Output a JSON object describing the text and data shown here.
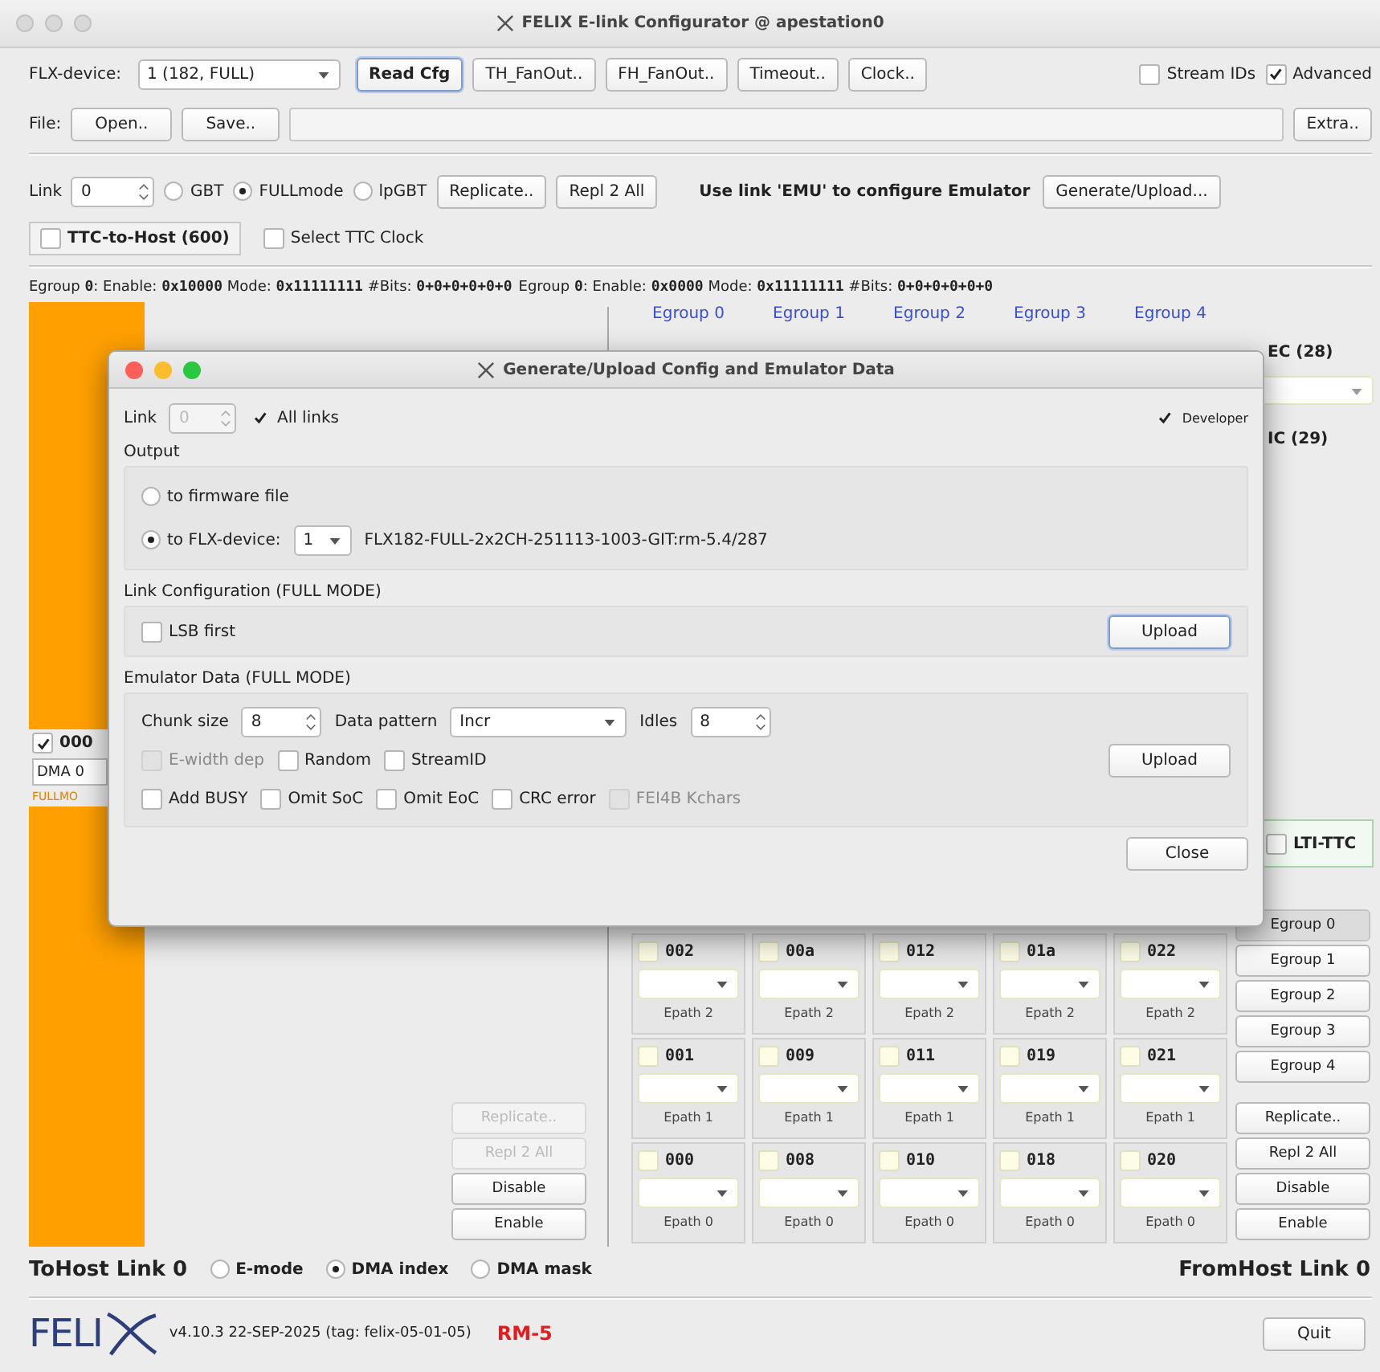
{
  "window": {
    "title": "FELIX E-link Configurator @ apestation0"
  },
  "toolbar": {
    "device_label": "FLX-device:",
    "device": "1 (182, FULL)",
    "buttons": [
      {
        "label": "Read Cfg",
        "kind": "default"
      },
      {
        "label": "TH_FanOut..",
        "kind": "plain"
      },
      {
        "label": "FH_FanOut..",
        "kind": "plain"
      },
      {
        "label": "Timeout..",
        "kind": "plain"
      },
      {
        "label": "Clock..",
        "kind": "plain"
      }
    ],
    "checkboxes": [
      {
        "label": "Stream IDs",
        "checked": false
      },
      {
        "label": "Advanced",
        "checked": true
      }
    ]
  },
  "file_row": {
    "label": "File:",
    "buttons": [
      "Open..",
      "Save.."
    ],
    "extra": "Extra.."
  },
  "link_row": {
    "label": "Link",
    "link": "0",
    "modes": [
      {
        "label": "GBT",
        "selected": false
      },
      {
        "label": "FULLmode",
        "selected": true
      },
      {
        "label": "lpGBT",
        "selected": false
      }
    ],
    "buttons": [
      "Replicate..",
      "Repl 2 All"
    ],
    "hint": "Use link 'EMU' to configure Emulator",
    "generate": "Generate/Upload..."
  },
  "ttc_row": [
    {
      "label": "TTC-to-Host (600)",
      "checked": false,
      "kind": "framed"
    },
    {
      "label": "Select TTC Clock",
      "checked": false,
      "kind": "plain"
    }
  ],
  "egroup_info": [
    "Egroup **0**: Enable: **0x10000** Mode: **0x11111111** #Bits: **0+0+0+0+0+0**",
    "Egroup **0**: Enable: **0x0000** Mode: **0x11111111** #Bits: **0+0+0+0+0+0**"
  ],
  "tohost": {
    "egroup": {
      "label": "000",
      "checked": true,
      "dma": "DMA 0",
      "mode": "FULLMO"
    },
    "buttons": [
      {
        "label": "Replicate..",
        "disabled": true
      },
      {
        "label": "Repl 2 All",
        "disabled": true
      },
      {
        "label": "Disable",
        "disabled": false
      },
      {
        "label": "Enable",
        "disabled": false
      }
    ]
  },
  "fromhost": {
    "egroup_headers": [
      "Egroup 0",
      "Egroup 1",
      "Egroup 2",
      "Egroup 3",
      "Egroup 4"
    ],
    "side": [
      {
        "kind": "label",
        "text": "EC (28)"
      },
      {
        "kind": "dropdown"
      },
      {
        "kind": "label",
        "text": "IC (29)"
      }
    ],
    "lti_ttc": {
      "label": "LTI-TTC",
      "checked": false
    },
    "rows": [
      {
        "cells": [
          {
            "id": "002",
            "checked": false,
            "epath": "Epath 2"
          },
          {
            "id": "00a",
            "checked": false,
            "epath": "Epath 2"
          },
          {
            "id": "012",
            "checked": false,
            "epath": "Epath 2"
          },
          {
            "id": "01a",
            "checked": false,
            "epath": "Epath 2"
          },
          {
            "id": "022",
            "checked": false,
            "epath": "Epath 2"
          }
        ]
      },
      {
        "cells": [
          {
            "id": "001",
            "checked": false,
            "epath": "Epath 1"
          },
          {
            "id": "009",
            "checked": false,
            "epath": "Epath 1"
          },
          {
            "id": "011",
            "checked": false,
            "epath": "Epath 1"
          },
          {
            "id": "019",
            "checked": false,
            "epath": "Epath 1"
          },
          {
            "id": "021",
            "checked": false,
            "epath": "Epath 1"
          }
        ]
      },
      {
        "cells": [
          {
            "id": "000",
            "checked": false,
            "epath": "Epath 0"
          },
          {
            "id": "008",
            "checked": false,
            "epath": "Epath 0"
          },
          {
            "id": "010",
            "checked": false,
            "epath": "Epath 0"
          },
          {
            "id": "018",
            "checked": false,
            "epath": "Epath 0"
          },
          {
            "id": "020",
            "checked": false,
            "epath": "Epath 0"
          }
        ]
      }
    ],
    "egroup_buttons": [
      {
        "label": "Egroup 0",
        "selected": true
      },
      {
        "label": "Egroup 1",
        "selected": false
      },
      {
        "label": "Egroup 2",
        "selected": false
      },
      {
        "label": "Egroup 3",
        "selected": false
      },
      {
        "label": "Egroup 4",
        "selected": false
      }
    ],
    "buttons": [
      {
        "label": "Replicate..",
        "disabled": false
      },
      {
        "label": "Repl 2 All",
        "disabled": false
      },
      {
        "label": "Disable",
        "disabled": false
      },
      {
        "label": "Enable",
        "disabled": false
      }
    ]
  },
  "footer": {
    "tohost_title": "ToHost Link 0",
    "modes": [
      {
        "label": "E-mode",
        "selected": false
      },
      {
        "label": "DMA index",
        "selected": true
      },
      {
        "label": "DMA mask",
        "selected": false
      }
    ],
    "fromhost_title": "FromHost Link 0",
    "logo": "FELI",
    "version": "v4.10.3  22-SEP-2025 (tag: felix-05-01-05)",
    "release": "RM-5",
    "quit": "Quit"
  },
  "dialog": {
    "title": "Generate/Upload Config and Emulator Data",
    "link_label": "Link",
    "link": "0",
    "link_disabled": true,
    "all_links": {
      "label": "All links",
      "checked": true
    },
    "developer": {
      "label": "Developer",
      "checked": true
    },
    "output_title": "Output",
    "targets": [
      {
        "label": "to firmware file",
        "selected": false
      },
      {
        "label": "to FLX-device:",
        "selected": true,
        "device": "1",
        "firmware": "FLX182-FULL-2x2CH-251113-1003-GIT:rm-5.4/287"
      }
    ],
    "link_config": {
      "title": "Link Configuration (FULL MODE)",
      "lsb": {
        "label": "LSB first",
        "checked": false
      },
      "upload": "Upload"
    },
    "emulator": {
      "title": "Emulator Data (FULL MODE)",
      "chunk_label": "Chunk size",
      "chunk": "8",
      "pattern_label": "Data pattern",
      "pattern": "Incr",
      "idles_label": "Idles",
      "idles": "8",
      "option_rows": [
        [
          {
            "label": "E-width dep",
            "checked": false,
            "disabled": true
          },
          {
            "label": "Random",
            "checked": false,
            "disabled": false
          },
          {
            "label": "StreamID",
            "checked": false,
            "disabled": false
          }
        ],
        [
          {
            "label": "Add BUSY",
            "checked": false,
            "disabled": false
          },
          {
            "label": "Omit SoC",
            "checked": false,
            "disabled": false
          },
          {
            "label": "Omit EoC",
            "checked": false,
            "disabled": false
          },
          {
            "label": "CRC error",
            "checked": false,
            "disabled": false
          },
          {
            "label": "FEI4B Kchars",
            "checked": false,
            "disabled": true
          }
        ]
      ],
      "upload": "Upload"
    },
    "close": "Close"
  }
}
